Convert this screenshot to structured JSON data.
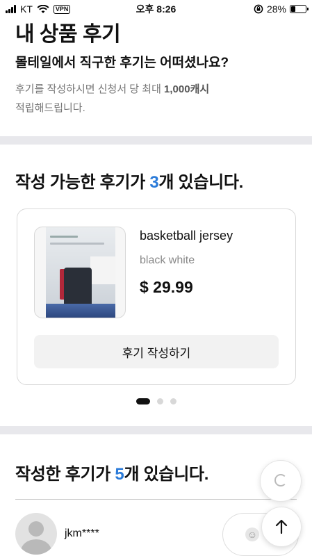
{
  "status_bar": {
    "carrier": "KT",
    "vpn": "VPN",
    "time": "오후 8:26",
    "battery": "28%",
    "battery_level": 0.28
  },
  "header": {
    "title": "내 상품 후기",
    "subtitle": "몰테일에서 직구한 후기는 어떠셨나요?",
    "desc_prefix": "후기를 작성하시면 신청서 당 최대 ",
    "desc_bold": "1,000캐시",
    "desc_suffix": "적립해드립니다."
  },
  "available": {
    "title_prefix": "작성 가능한 후기가 ",
    "count": "3",
    "title_suffix": "개 있습니다.",
    "card": {
      "product_name": "basketball jersey",
      "variant": "black white",
      "price": "$ 29.99",
      "write_button": "후기 작성하기"
    },
    "page_index": 0,
    "page_count": 3
  },
  "written": {
    "title_prefix": "작성한 후기가 ",
    "count": "5",
    "title_suffix": "개 있습니다.",
    "reviews": [
      {
        "username": "jkm****"
      }
    ]
  },
  "floating": {
    "top_button": "↑",
    "smile": "☺"
  },
  "colors": {
    "accent": "#2b7bd9",
    "band": "#e8e8ec"
  }
}
